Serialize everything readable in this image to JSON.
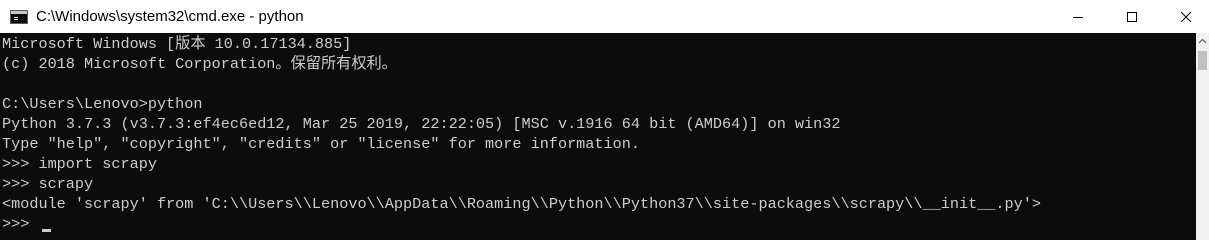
{
  "window": {
    "title": "C:\\Windows\\system32\\cmd.exe - python",
    "icon": "console-icon",
    "controls": [
      "minimize-icon",
      "maximize-icon",
      "close-icon"
    ]
  },
  "console": {
    "lines": [
      "Microsoft Windows [版本 10.0.17134.885]",
      "(c) 2018 Microsoft Corporation。保留所有权利。",
      "",
      "C:\\Users\\Lenovo>python",
      "Python 3.7.3 (v3.7.3:ef4ec6ed12, Mar 25 2019, 22:22:05) [MSC v.1916 64 bit (AMD64)] on win32",
      "Type \"help\", \"copyright\", \"credits\" or \"license\" for more information.",
      ">>> import scrapy",
      ">>> scrapy",
      "<module 'scrapy' from 'C:\\\\Users\\\\Lenovo\\\\AppData\\\\Roaming\\\\Python\\\\Python37\\\\site-packages\\\\scrapy\\\\__init__.py'>",
      ">>> "
    ]
  },
  "colors": {
    "console_bg": "#0c0c0c",
    "console_text": "#cccccc",
    "titlebar_bg": "#ffffff"
  }
}
